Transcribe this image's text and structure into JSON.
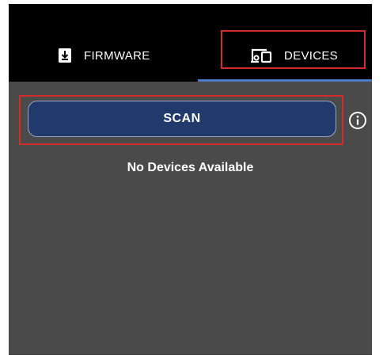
{
  "tabs": {
    "firmware_label": "FIRMWARE",
    "devices_label": "DEVICES",
    "firmware_icon": "download-box-icon",
    "devices_icon": "devices-icon",
    "selected": "DEVICES"
  },
  "main": {
    "scan_label": "SCAN",
    "info_icon": "info-icon",
    "empty_message": "No Devices Available"
  },
  "colors": {
    "tab_background": "#000000",
    "content_background": "#4a4a4a",
    "button_background": "#213a6b",
    "accent": "#4a78c9",
    "highlight": "#d22b2b"
  }
}
